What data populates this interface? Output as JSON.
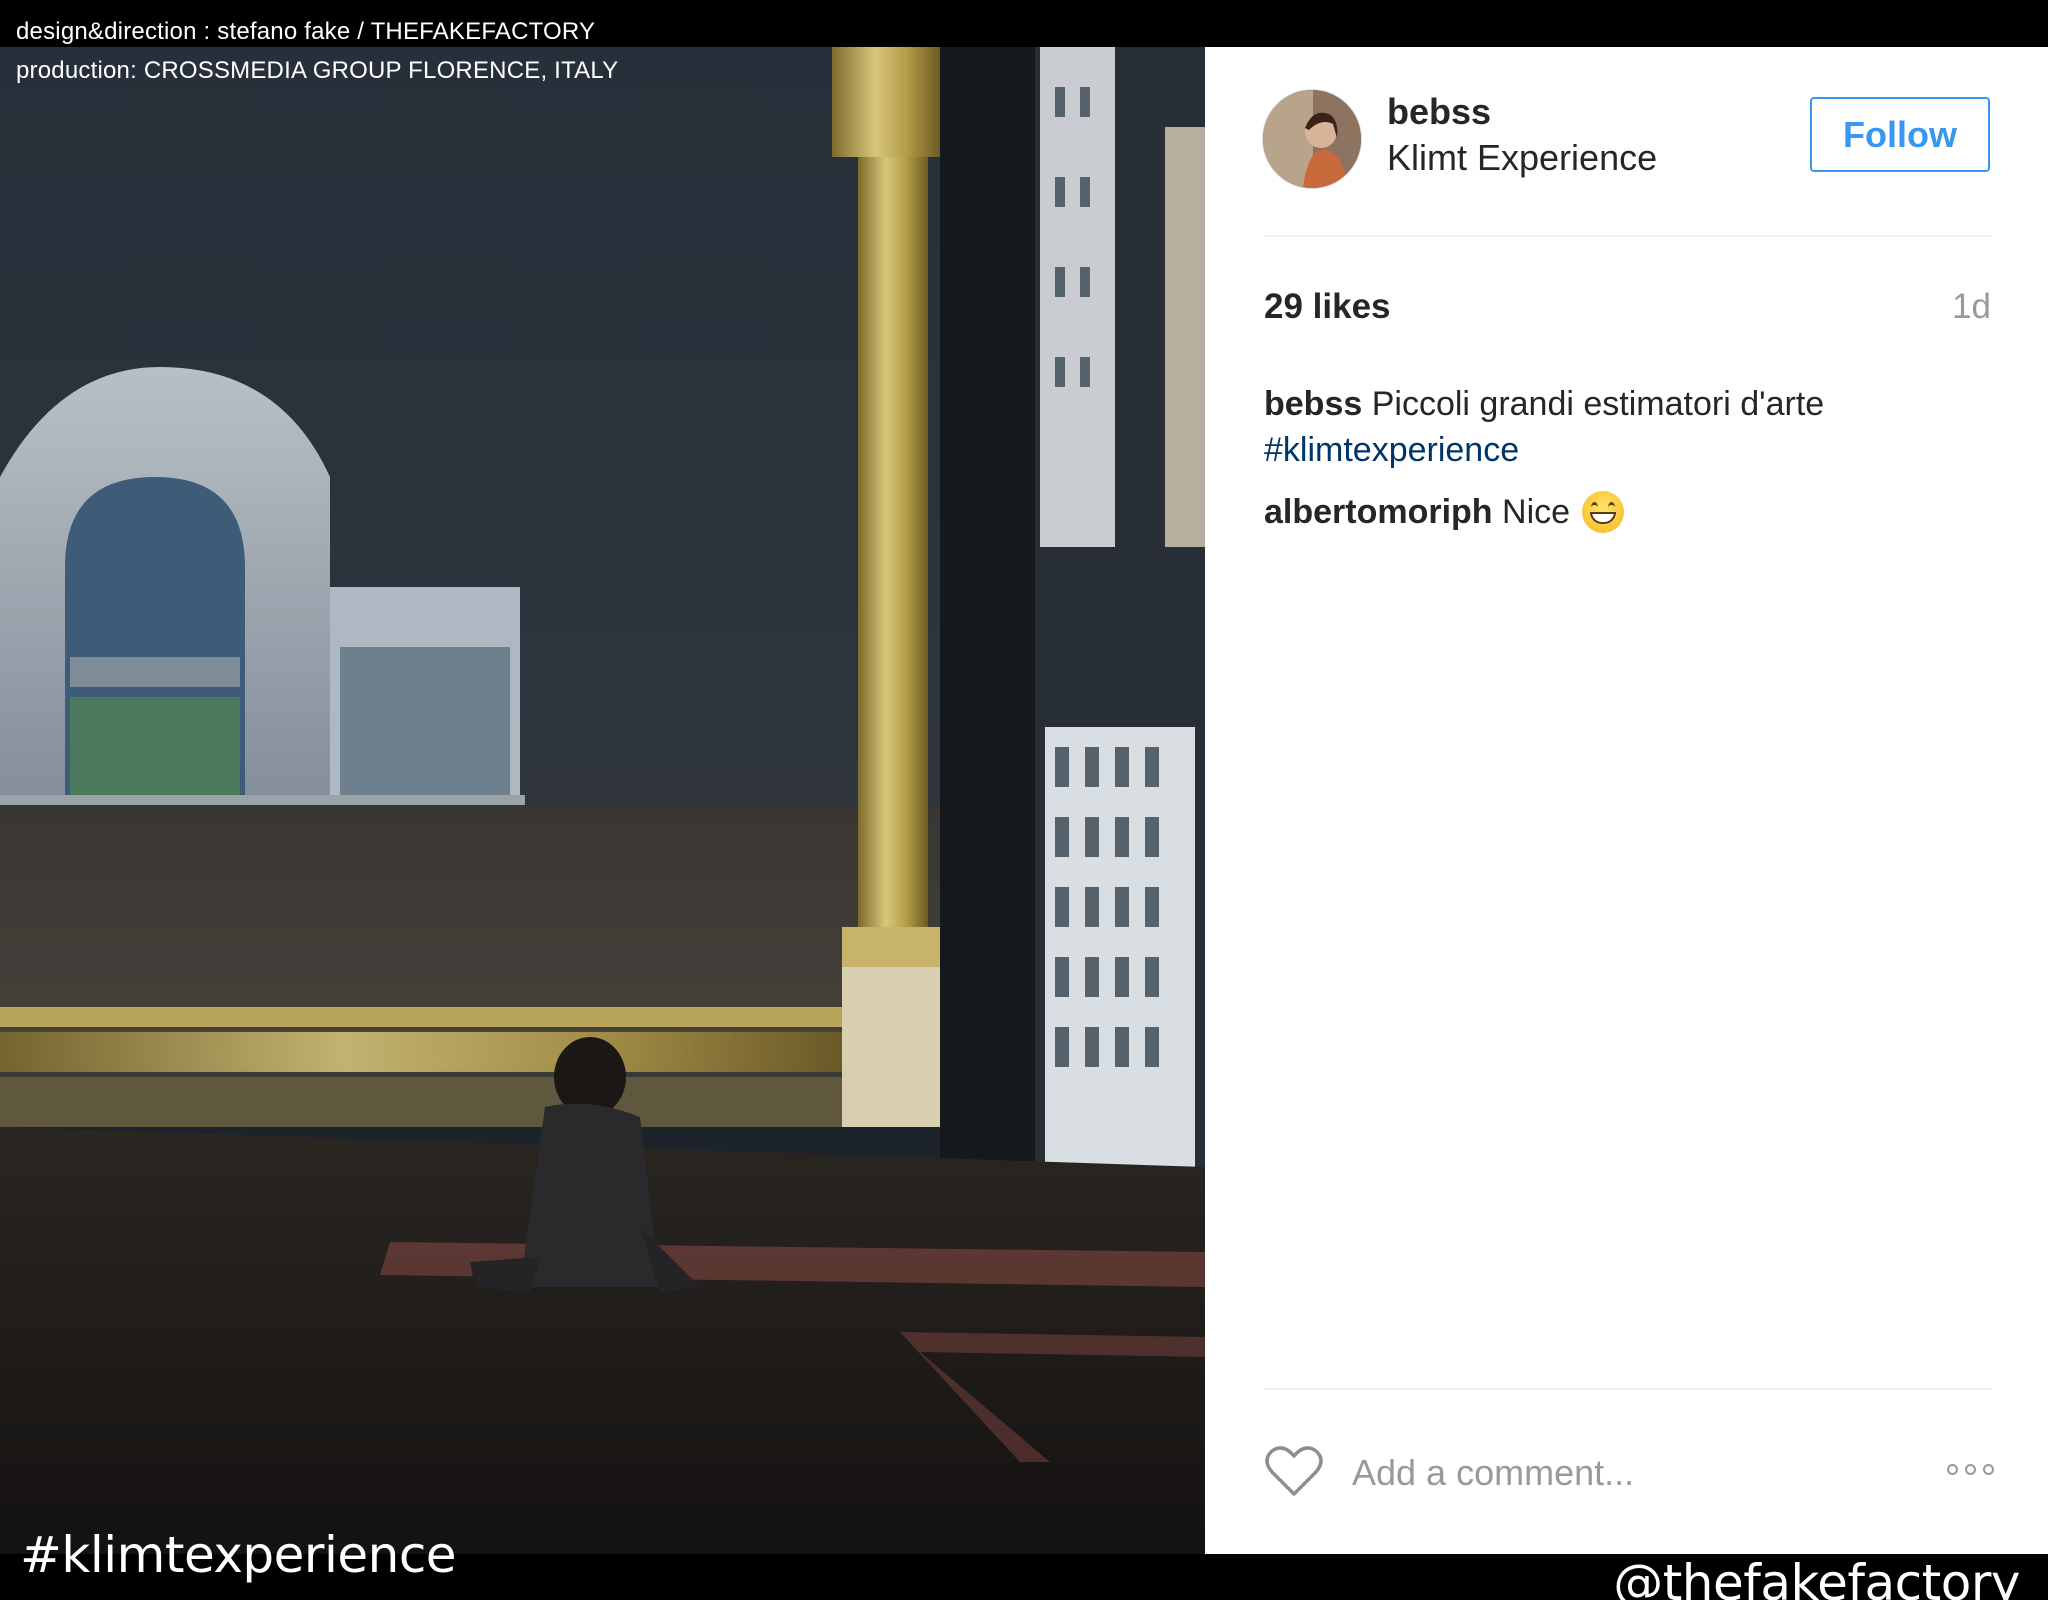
{
  "credits": {
    "line1": "design&direction : stefano fake / THEFAKEFACTORY",
    "line2": "production: CROSSMEDIA GROUP FLORENCE, ITALY"
  },
  "overlay": {
    "hashtag": "#klimtexperience",
    "handle": "@thefakefactory"
  },
  "post": {
    "username": "bebss",
    "location": "Klimt Experience",
    "follow_label": "Follow",
    "likes": "29 likes",
    "age": "1d",
    "caption_user": "bebss",
    "caption_text": "Piccoli grandi estimatori d'arte",
    "caption_hashtag": "#klimtexperience",
    "comments": [
      {
        "user": "albertomoriph",
        "text": "Nice",
        "emoji": "grinning-face-emoji"
      }
    ],
    "comment_placeholder": "Add a comment...",
    "icons": {
      "like": "heart-icon",
      "more": "more-options-icon"
    }
  },
  "colors": {
    "follow_blue": "#3897f0",
    "hashtag_blue": "#003569",
    "text_dark": "#262626",
    "muted": "#999999"
  }
}
